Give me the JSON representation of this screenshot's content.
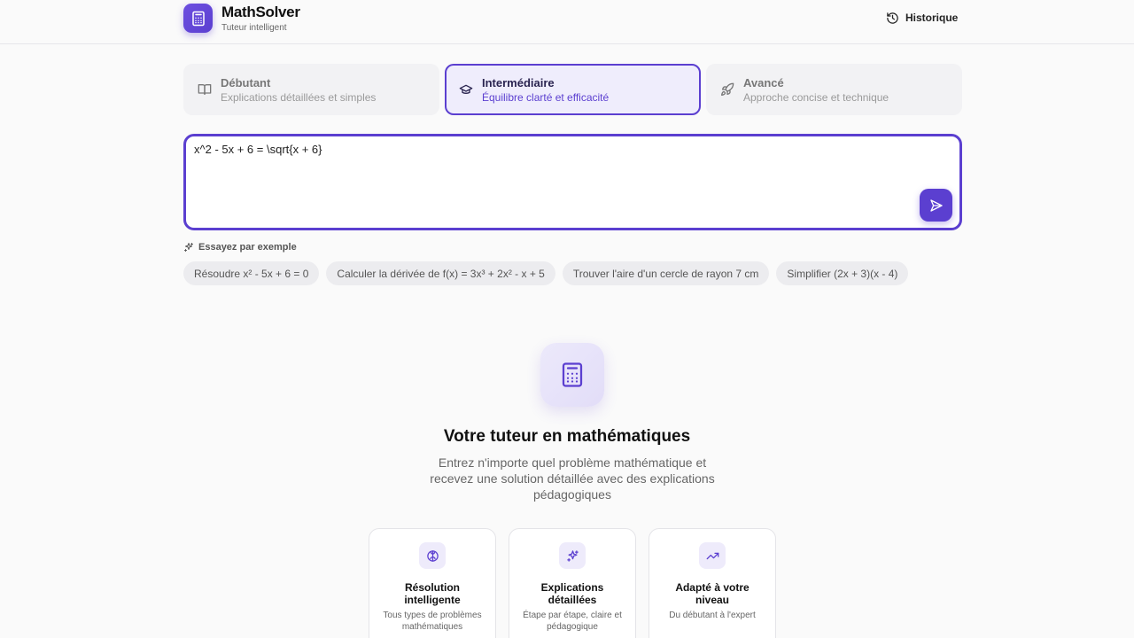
{
  "header": {
    "title": "MathSolver",
    "subtitle": "Tuteur intelligent",
    "history_label": "Historique"
  },
  "levels": [
    {
      "title": "Débutant",
      "desc": "Explications détaillées et simples",
      "icon": "book-icon",
      "active": false
    },
    {
      "title": "Intermédiaire",
      "desc": "Équilibre clarté et efficacité",
      "icon": "graduation-cap-icon",
      "active": true
    },
    {
      "title": "Avancé",
      "desc": "Approche concise et technique",
      "icon": "rocket-icon",
      "active": false
    }
  ],
  "editor": {
    "value": "x^2 - 5x + 6 = \\sqrt{x + 6}"
  },
  "examples": {
    "label": "Essayez par exemple",
    "items": [
      "Résoudre x² - 5x + 6 = 0",
      "Calculer la dérivée de f(x) = 3x³ + 2x² - x + 5",
      "Trouver l'aire d'un cercle de rayon 7 cm",
      "Simplifier (2x + 3)(x - 4)"
    ]
  },
  "hero": {
    "title": "Votre tuteur en mathématiques",
    "description": "Entrez n'importe quel problème mathématique et recevez une solution détaillée avec des explications pédagogiques"
  },
  "features": [
    {
      "title": "Résolution intelligente",
      "desc": "Tous types de problèmes mathématiques",
      "icon": "brain-icon"
    },
    {
      "title": "Explications détaillées",
      "desc": "Étape par étape, claire et pédagogique",
      "icon": "sparkles-icon"
    },
    {
      "title": "Adapté à votre niveau",
      "desc": "Du débutant à l'expert",
      "icon": "trending-up-icon"
    }
  ],
  "colors": {
    "accent": "#5b3fd0",
    "accent_light": "#efedfc"
  }
}
